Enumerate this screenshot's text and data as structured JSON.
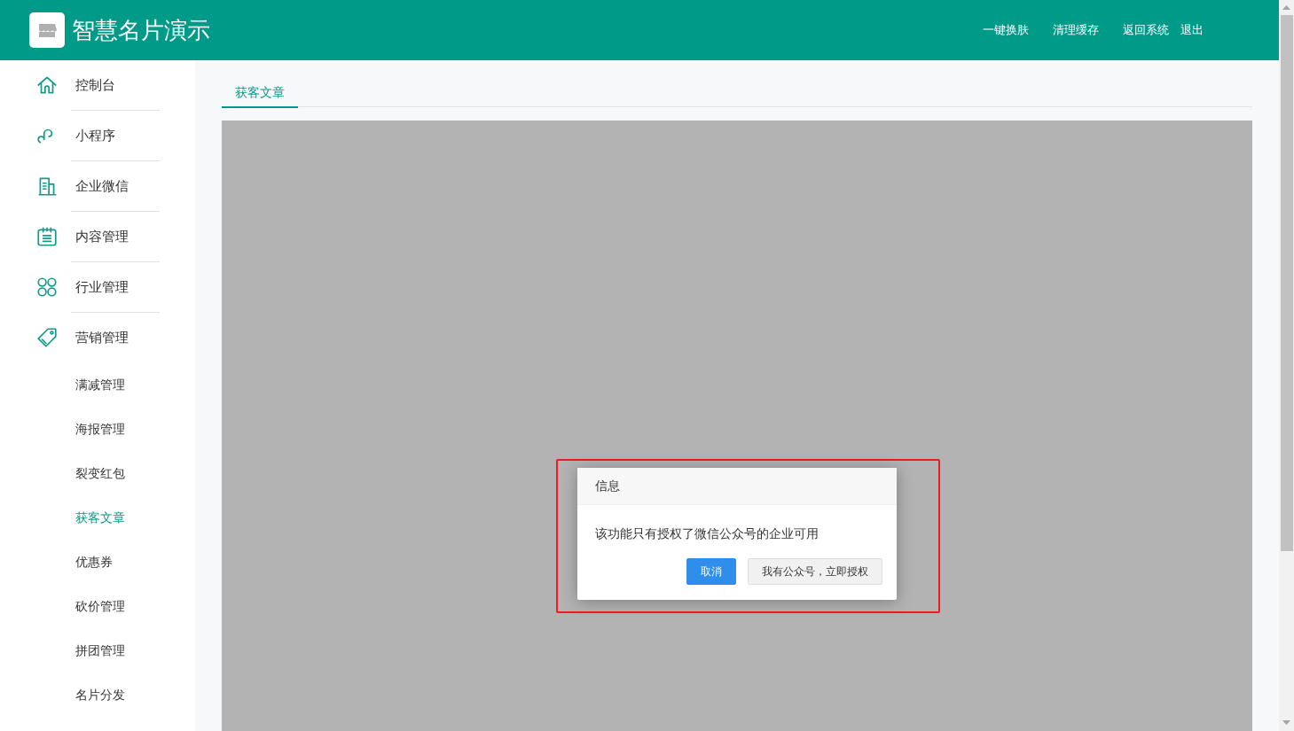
{
  "header": {
    "title": "智慧名片演示",
    "links": [
      "一键换肤",
      "清理缓存",
      "返回系统",
      "退出"
    ]
  },
  "sidebar": {
    "items": [
      {
        "label": "控制台"
      },
      {
        "label": "小程序"
      },
      {
        "label": "企业微信"
      },
      {
        "label": "内容管理"
      },
      {
        "label": "行业管理"
      },
      {
        "label": "营销管理",
        "children": [
          {
            "label": "满减管理",
            "selected": false
          },
          {
            "label": "海报管理",
            "selected": false
          },
          {
            "label": "裂变红包",
            "selected": false
          },
          {
            "label": "获客文章",
            "selected": true
          },
          {
            "label": "优惠券",
            "selected": false
          },
          {
            "label": "砍价管理",
            "selected": false
          },
          {
            "label": "拼团管理",
            "selected": false
          },
          {
            "label": "名片分发",
            "selected": false
          }
        ]
      }
    ]
  },
  "tabs": [
    {
      "label": "获客文章",
      "selected": true
    }
  ],
  "dialog": {
    "title": "信息",
    "message": "该功能只有授权了微信公众号的企业可用",
    "buttons": [
      {
        "label": "取消",
        "kind": "primary"
      },
      {
        "label": "我有公众号，立即授权",
        "kind": "default"
      }
    ]
  }
}
